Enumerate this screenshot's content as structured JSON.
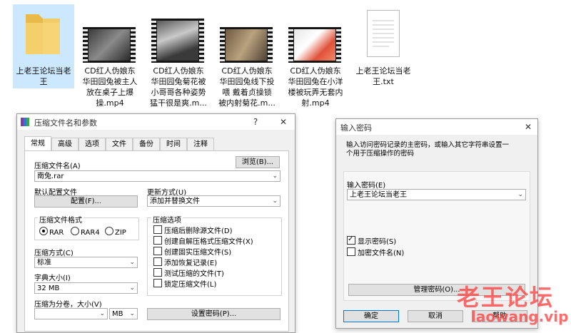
{
  "desktop": {
    "files": [
      {
        "label": "上老王论坛当老\n王",
        "type": "folder"
      },
      {
        "label": "CD红人伪娘东\n华田园兔被主人\n放在桌子上爆\n操.mp4",
        "type": "video"
      },
      {
        "label": "CD红人伪娘东\n华田园兔菊花被\n小哥哥各种姿势\n猛干很是爽.m...",
        "type": "video"
      },
      {
        "label": "CD红人伪娘东\n华田园兔线下投\n喂 戴着贞操锁\n被内射菊花.m...",
        "type": "video"
      },
      {
        "label": "CD红人伪娘东\n华田园兔在小洋\n楼被玩弄无套内\n射.mp4",
        "type": "video"
      },
      {
        "label": "上老王论坛当老\n王.txt",
        "type": "text"
      }
    ]
  },
  "archive_dialog": {
    "title": "压缩文件名和参数",
    "help_btn": "?",
    "close_btn": "✕",
    "tabs": [
      "常规",
      "高级",
      "选项",
      "文件",
      "备份",
      "时间",
      "注释"
    ],
    "archive_name_label": "压缩文件名(A)",
    "browse_btn": "浏览(B)...",
    "archive_name_value": "南兔.rar",
    "default_profile_label": "默认配置文件",
    "profiles_btn": "配置(F)...",
    "update_mode_label": "更新方式(U)",
    "update_mode_value": "添加并替换文件",
    "format_group_label": "压缩文件格式",
    "formats": [
      "RAR",
      "RAR4",
      "ZIP"
    ],
    "selected_format": "RAR",
    "options_group_label": "压缩选项",
    "options": [
      {
        "label": "压缩后删除源文件(D)",
        "checked": false
      },
      {
        "label": "创建自解压格式压缩文件(X)",
        "checked": false
      },
      {
        "label": "创建固实压缩文件(S)",
        "checked": false
      },
      {
        "label": "添加恢复记录(E)",
        "checked": false
      },
      {
        "label": "测试压缩的文件(T)",
        "checked": false
      },
      {
        "label": "锁定压缩文件(L)",
        "checked": false
      }
    ],
    "method_label": "压缩方式(C)",
    "method_value": "标准",
    "dict_label": "字典大小(I)",
    "dict_value": "32 MB",
    "split_label": "压缩为分卷，大小(V)",
    "split_value": "",
    "split_unit": "MB",
    "set_password_btn": "设置密码(P)..."
  },
  "password_dialog": {
    "title": "输入密码",
    "close_btn": "✕",
    "description": "输入访问密码记录的主密码，或输入其它字符串设置一\n个用于压缩操作的密码",
    "password_label": "输入密码(E)",
    "password_value": "上老王论坛当老王",
    "show_password_label": "显示密码(S)",
    "show_password_checked": true,
    "encrypt_names_label": "加密文件名(N)",
    "encrypt_names_checked": false,
    "organize_btn": "管理密码(O)...",
    "ok_btn": "确定",
    "cancel_btn": "取消",
    "help_btn": "帮助"
  },
  "watermark": {
    "line1": "老王论坛",
    "line2": "laowang.vip",
    "color": "#ff3b3b"
  }
}
